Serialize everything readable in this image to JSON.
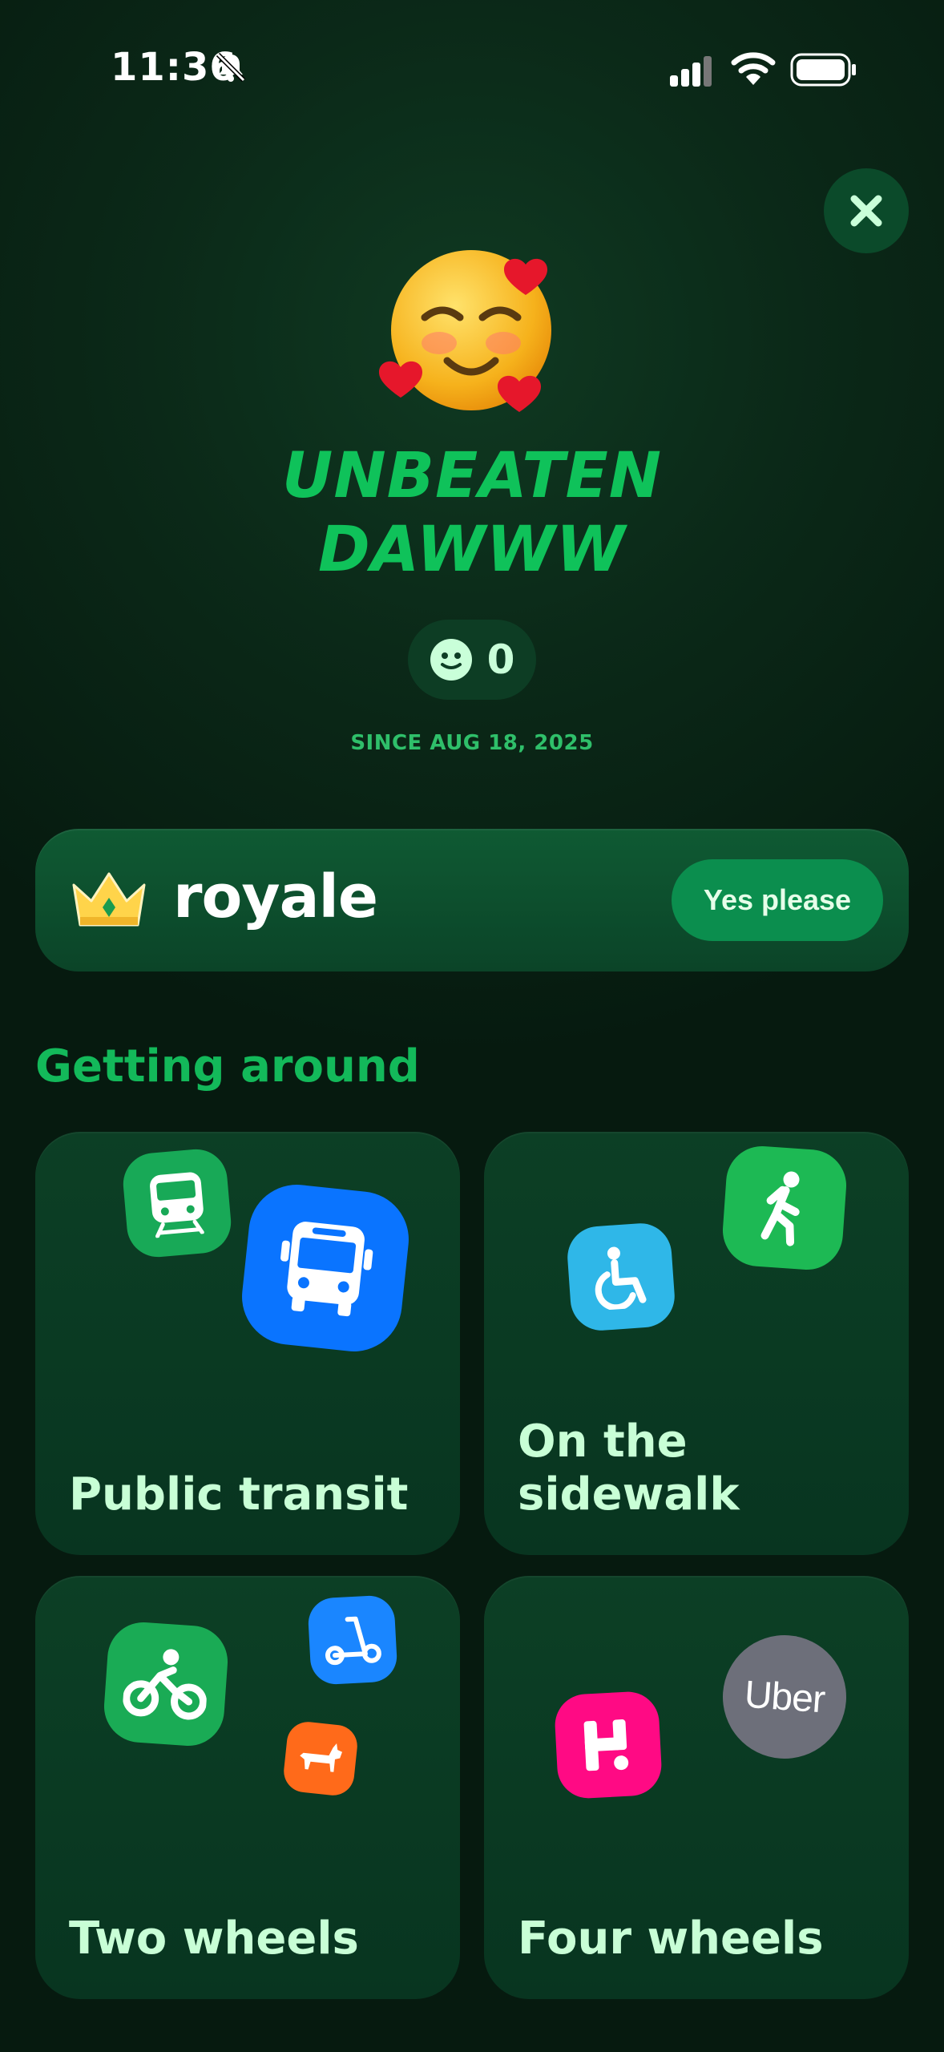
{
  "status_bar": {
    "time": "11:36",
    "icons": [
      "bell-muted-icon",
      "cellular-signal-icon",
      "wifi-icon",
      "battery-icon"
    ]
  },
  "close_button": {
    "icon": "close-icon"
  },
  "profile": {
    "emoji": "smiling-face-with-hearts",
    "title_line1": "UNBEATEN",
    "title_line2": "DAWWW",
    "score": "0",
    "since": "SINCE AUG 18, 2025"
  },
  "royale": {
    "logo_text": "royale",
    "cta_label": "Yes please"
  },
  "section": {
    "title": "Getting around"
  },
  "tiles": [
    {
      "label": "Public transit",
      "icons": [
        "train-icon",
        "bus-icon"
      ]
    },
    {
      "label_line1": "On the",
      "label_line2": "sidewalk",
      "icons": [
        "wheelchair-icon",
        "walking-icon"
      ]
    },
    {
      "label": "Two wheels",
      "icons": [
        "bike-icon",
        "scooter-icon",
        "donkey-icon"
      ]
    },
    {
      "label": "Four wheels",
      "icons": [
        "hopp-icon",
        "uber-icon"
      ],
      "uber_text": "Uber"
    }
  ],
  "colors": {
    "accent_green": "#0fc25a",
    "bus_blue": "#0a74ff",
    "walk_green": "#1db954",
    "wheelchair_cyan": "#2fb7e8",
    "scooter_blue": "#1a86ff",
    "donkey_orange": "#ff6a1a",
    "hopp_pink": "#ff0a84",
    "uber_gray": "#6d6f7a"
  }
}
